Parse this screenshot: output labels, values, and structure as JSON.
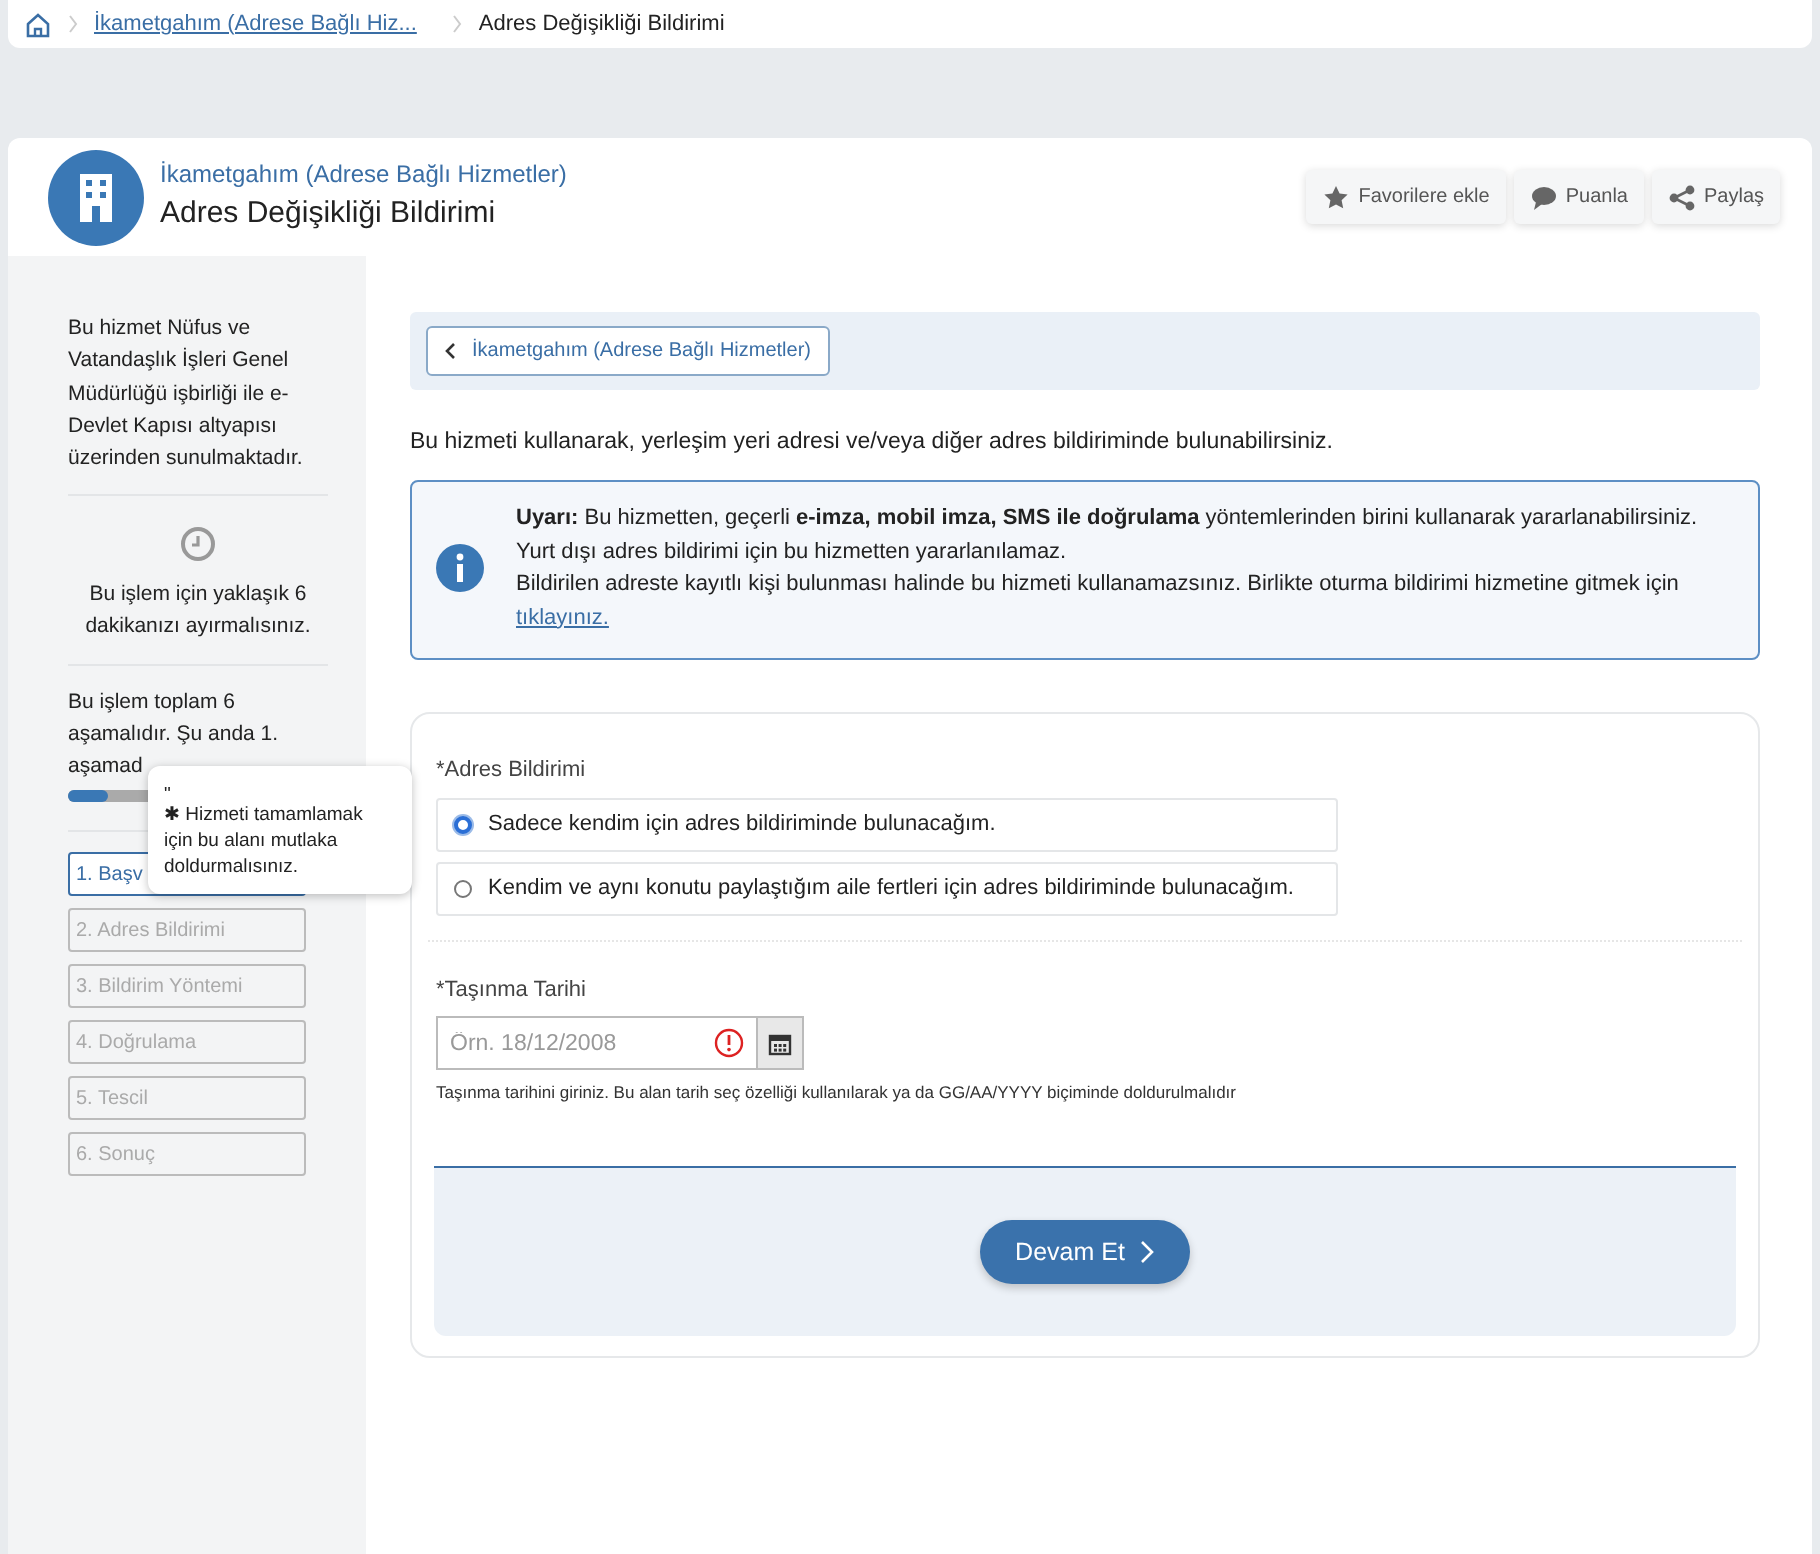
{
  "breadcrumb": {
    "items": [
      "İkametgahım (Adrese Bağlı Hiz...",
      "Adres Değişikliği Bildirimi"
    ]
  },
  "header": {
    "category": "İkametgahım (Adrese Bağlı Hizmetler)",
    "title": "Adres Değişikliği Bildirimi",
    "actions": [
      {
        "kind": "star",
        "label": "Favorilere ekle"
      },
      {
        "kind": "chat",
        "label": "Puanla"
      },
      {
        "kind": "share",
        "label": "Paylaş"
      }
    ]
  },
  "sidebar": {
    "about": "Bu hizmet Nüfus ve Vatandaşlık İşleri Genel Müdürlüğü işbirliği ile e-Devlet Kapısı altyapısı üzerinden sunulmaktadır.",
    "duration": "Bu işlem için yaklaşık 6 dakikanızı ayırmalısınız.",
    "progress_text": "Bu işlem toplam 6 aşamalıdır. Şu anda 1. aşamad",
    "progress": {
      "level": 0.17
    },
    "steps": [
      {
        "label": "1. Başv",
        "selected": true
      },
      {
        "label": "2. Adres Bildirimi",
        "selected": false
      },
      {
        "label": "3. Bildirim Yöntemi",
        "selected": false
      },
      {
        "label": "4. Doğrulama",
        "selected": false
      },
      {
        "label": "5. Tescil",
        "selected": false
      },
      {
        "label": "6. Sonuç",
        "selected": false
      }
    ]
  },
  "tooltip": {
    "lines": [
      "\"",
      "✱ Hizmeti tamamlamak için bu alanı mutlaka doldurmalısınız."
    ]
  },
  "main": {
    "back_link": "İkametgahım (Adrese Bağlı Hizmetler)",
    "intro": "Bu hizmeti kullanarak, yerleşim yeri adresi ve/veya diğer adres bildiriminde bulunabilirsiniz.",
    "alert": {
      "lines": [
        "**Uyarı:** Bu hizmetten, geçerli **e-imza, mobil imza, SMS ile doğrulama** yöntemlerinden birini kullanarak yararlanabilirsiniz.",
        "Yurt dışı adres bildirimi için bu hizmetten yararlanılamaz.",
        "Bildirilen adreste kayıtlı kişi bulunması halinde bu hizmeti kullanamazsınız. Birlikte oturma bildirimi hizmetine gitmek için"
      ],
      "link": "tıklayınız."
    },
    "form": {
      "address_label": "*Adres Bildirimi",
      "options": [
        {
          "label": "Sadece kendim için adres bildiriminde bulunacağım.",
          "selected": true
        },
        {
          "label": "Kendim ve aynı konutu paylaştığım aile fertleri için adres bildiriminde bulunacağım.",
          "selected": false
        }
      ],
      "date_label": "*Taşınma Tarihi",
      "date_placeholder": "Örn. 18/12/2008",
      "date_error": true,
      "date_help": "Taşınma tarihini giriniz. Bu alan tarih seç özelliği kullanılarak ya da GG/AA/YYYY biçiminde doldurulmalıdır",
      "submit": "Devam Et"
    }
  }
}
